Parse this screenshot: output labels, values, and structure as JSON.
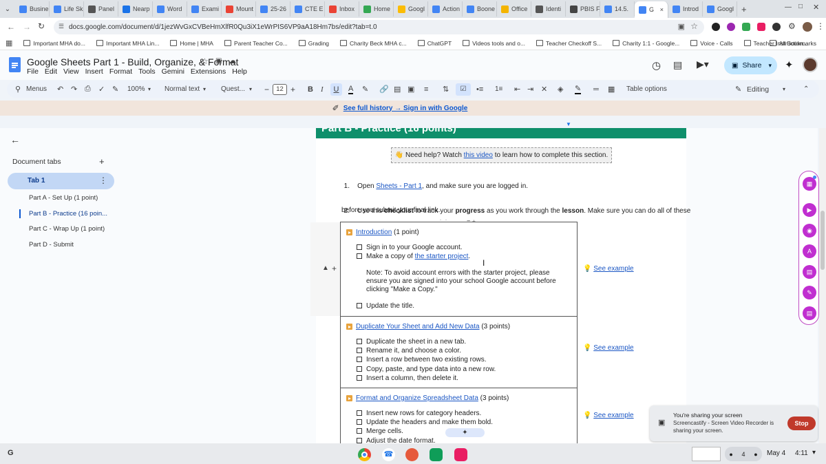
{
  "browser": {
    "tabs": [
      {
        "label": "Busine",
        "color": "#4285f4"
      },
      {
        "label": "Life Sk",
        "color": "#4285f4"
      },
      {
        "label": "Panel",
        "color": "#555555"
      },
      {
        "label": "Nearp",
        "color": "#1a73e8"
      },
      {
        "label": "Word",
        "color": "#4285f4"
      },
      {
        "label": "Exami",
        "color": "#4285f4"
      },
      {
        "label": "Mount",
        "color": "#ea4335"
      },
      {
        "label": "25-26",
        "color": "#4285f4"
      },
      {
        "label": "CTE E",
        "color": "#4285f4"
      },
      {
        "label": "Inbox",
        "color": "#ea4335"
      },
      {
        "label": "Home",
        "color": "#34a853"
      },
      {
        "label": "Googl",
        "color": "#fbbc04"
      },
      {
        "label": "Action",
        "color": "#4285f4"
      },
      {
        "label": "Boone",
        "color": "#4285f4"
      },
      {
        "label": "Office",
        "color": "#f4b400"
      },
      {
        "label": "Identi",
        "color": "#555555"
      },
      {
        "label": "PBIS F",
        "color": "#444444"
      },
      {
        "label": "14.5.",
        "color": "#4285f4"
      },
      {
        "label": "G",
        "color": "#4285f4",
        "active": true
      },
      {
        "label": "Introd",
        "color": "#4285f4"
      },
      {
        "label": "Googl",
        "color": "#4285f4"
      }
    ],
    "url": "docs.google.com/document/d/1jezWvGxCVBeHmXlfR0Qu3iX1eWrPIS6VP9aA18Hm7bs/edit?tab=t.0",
    "bookmarks": [
      "Important MHA do...",
      "Important MHA Lin...",
      "Home | MHA",
      "Parent Teacher Co...",
      "Grading",
      "Charity Beck MHA c...",
      "ChatGPT",
      "Videos tools and o...",
      "Teacher Checkoff S...",
      "Charity 1:1 - Google...",
      "Voice - Calls",
      "Teacher Instruction..."
    ],
    "all_bookmarks": "All Bookmarks"
  },
  "doc": {
    "title": "Google Sheets Part 1 - Build, Organize, & Format",
    "menu": [
      "File",
      "Edit",
      "View",
      "Insert",
      "Format",
      "Tools",
      "Gemini",
      "Extensions",
      "Help"
    ],
    "share_label": "Share"
  },
  "toolbar": {
    "menus_label": "Menus",
    "zoom": "100%",
    "style": "Normal text",
    "font": "Quest...",
    "font_size": "12",
    "table_options": "Table options",
    "mode": "Editing"
  },
  "history_bar": {
    "text": "See full history → Sign in with Google"
  },
  "sidebar": {
    "heading": "Document tabs",
    "tab": "Tab 1",
    "items": [
      "Part A - Set Up (1 point)",
      "Part B - Practice (16 poin...",
      "Part C - Wrap Up (1 point)",
      "Part D - Submit"
    ]
  },
  "content": {
    "banner_title": "Part B - Practice (16 points)",
    "help_prefix": "👋 Need help? Watch ",
    "help_link": "this video",
    "help_suffix": " to learn how to complete this section.",
    "step1_num": "1.",
    "step1_pre": "Open ",
    "step1_link": "Sheets - Part 1",
    "step1_post": ", and make sure you are logged in.",
    "step2_num": "2.",
    "step2_a": "Use this ",
    "step2_b": "checklist",
    "step2_c": " to track your ",
    "step2_d": "progress",
    "step2_e": " as you work through the ",
    "step2_f": "lesson",
    "step2_g": ". Make sure you can do all of these",
    "step2_line2": "before you submit your final link.",
    "sections": [
      {
        "title": "Introduction",
        "points": " (1 point)",
        "items": [
          "Sign in to your Google account.",
          "Make a copy of "
        ],
        "link": "the starter project",
        "link_suffix": ".",
        "note": [
          "Note: To avoid account errors with the starter project, please",
          "ensure you are signed into your school Google account before",
          "clicking \"Make a Copy.\""
        ],
        "last_item": "Update the title.",
        "example": "See example"
      },
      {
        "title": "Duplicate Your Sheet and Add New Data",
        "points": " (3 points)",
        "items": [
          "Duplicate the sheet in a new tab.",
          "Rename it, and choose a color.",
          "Insert a row between two existing rows.",
          "Copy, paste, and type data into a new row.",
          "Insert a column, then delete it."
        ],
        "example": "See example"
      },
      {
        "title": "Format and Organize Spreadsheet Data",
        "points": " (3 points)",
        "items": [
          "Insert new rows for category headers.",
          "Update the headers and make them bold.",
          "Merge cells.",
          "Adjust the date format."
        ],
        "example": "See example"
      }
    ]
  },
  "sharing_popup": {
    "title": "You're sharing your screen",
    "body_1": "Screencastify - Screen Video Recorder is",
    "body_2": "sharing your screen.",
    "stop": "Stop"
  },
  "taskbar": {
    "date": "May 4",
    "time": "4:11",
    "badge": "4"
  },
  "colors": {
    "banner": "#0f8f6b",
    "accent_blue": "#0b57d0",
    "rail": "#c02ed0",
    "stop_button": "#c0392b"
  }
}
